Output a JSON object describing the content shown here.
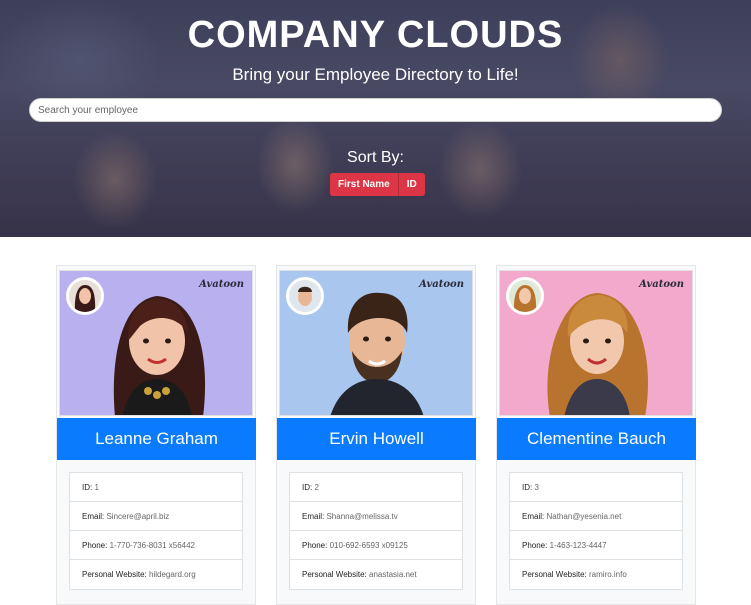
{
  "hero": {
    "title": "COMPANY CLOUDS",
    "subtitle": "Bring your Employee Directory to Life!"
  },
  "search": {
    "placeholder": "Search your employee",
    "value": ""
  },
  "sort": {
    "label": "Sort By:",
    "buttons": [
      "First Name",
      "ID"
    ],
    "color": "#dc3545"
  },
  "theme": {
    "name_bar_color": "#0a7bff"
  },
  "employees": [
    {
      "name": "Leanne Graham",
      "id_label": "ID:",
      "id": "1",
      "email_label": "Email:",
      "email": "Sincere@april.biz",
      "phone_label": "Phone:",
      "phone": "1-770-736-8031 x56442",
      "website_label": "Personal Website:",
      "website": "hildegard.org",
      "brand": "Avatoon",
      "bg_color": "#b9b0f0"
    },
    {
      "name": "Ervin Howell",
      "id_label": "ID:",
      "id": "2",
      "email_label": "Email:",
      "email": "Shanna@melissa.tv",
      "phone_label": "Phone:",
      "phone": "010-692-6593 x09125",
      "website_label": "Personal Website:",
      "website": "anastasia.net",
      "brand": "Avatoon",
      "bg_color": "#a9c6ee"
    },
    {
      "name": "Clementine Bauch",
      "id_label": "ID:",
      "id": "3",
      "email_label": "Email:",
      "email": "Nathan@yesenia.net",
      "phone_label": "Phone:",
      "phone": "1-463-123-4447",
      "website_label": "Personal Website:",
      "website": "ramiro.info",
      "brand": "Avatoon",
      "bg_color": "#f2a9cb"
    }
  ]
}
